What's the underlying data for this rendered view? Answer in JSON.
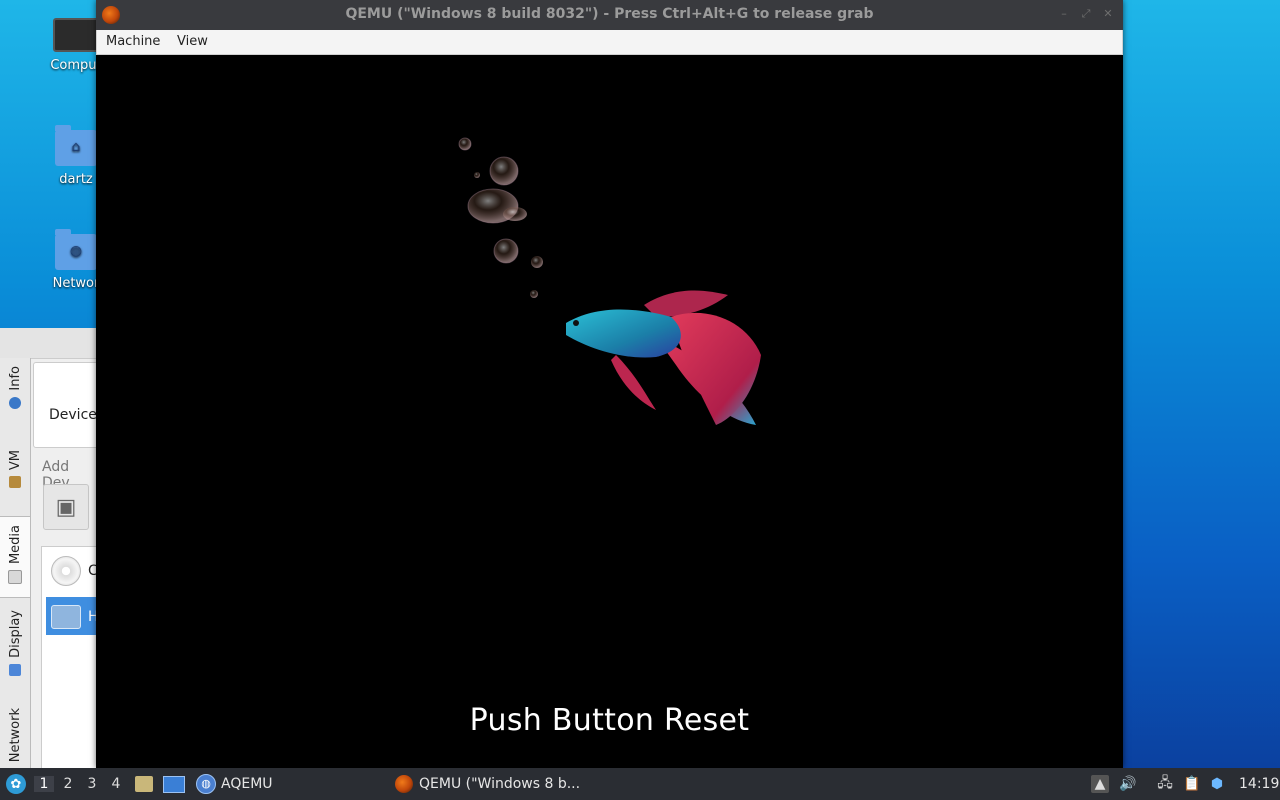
{
  "desktop": {
    "icons": [
      {
        "label": "Comput",
        "icon": "computer-icon"
      },
      {
        "label": "dartz",
        "icon": "home-folder-icon"
      },
      {
        "label": "Networ",
        "icon": "network-folder-icon"
      }
    ]
  },
  "aqemu": {
    "tabs": [
      {
        "label": "Info",
        "icon": "info-icon"
      },
      {
        "label": "VM",
        "icon": "tools-icon"
      },
      {
        "label": "Media",
        "icon": "disk-icon"
      },
      {
        "label": "Display",
        "icon": "display-icon"
      },
      {
        "label": "Network",
        "icon": "network-icon"
      }
    ],
    "devices_label": "Device",
    "add_devices_label": "Add Dev",
    "list": [
      {
        "label": "C",
        "icon": "cdrom-icon",
        "selected": false
      },
      {
        "label": "H",
        "icon": "harddisk-icon",
        "selected": true
      }
    ]
  },
  "qemu": {
    "title": "QEMU (\"Windows 8 build 8032\") - Press Ctrl+Alt+G to release grab",
    "menu": [
      "Machine",
      "View"
    ],
    "guest": {
      "status_text": "Push Button Reset",
      "background_color": "#000000"
    }
  },
  "taskbar": {
    "workspaces": [
      "1",
      "2",
      "3",
      "4"
    ],
    "active_workspace": "1",
    "tasks": [
      {
        "label": "AQEMU",
        "icon": "aqemu-icon"
      },
      {
        "label": "QEMU (\"Windows 8 b...",
        "icon": "qemu-icon"
      }
    ],
    "clock": "14:19"
  }
}
